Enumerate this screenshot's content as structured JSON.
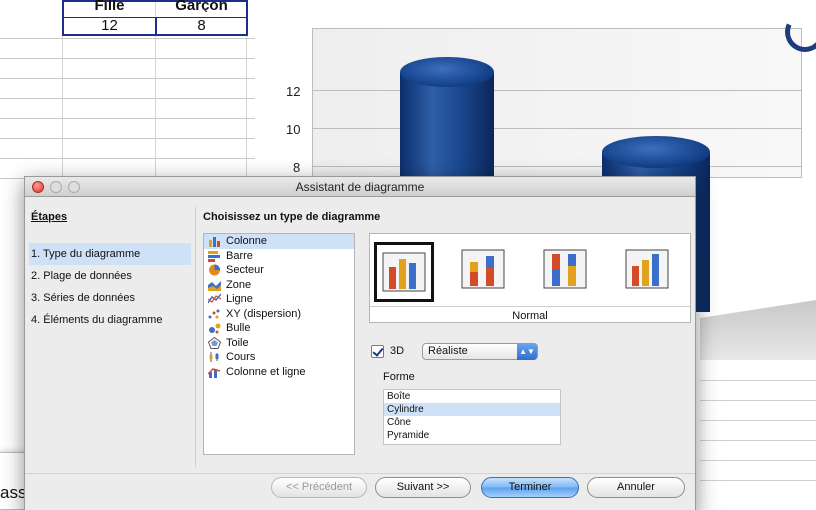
{
  "spreadsheet": {
    "headers": [
      "Fille",
      "Garçon"
    ],
    "values": [
      "12",
      "8"
    ]
  },
  "chart": {
    "y_ticks": [
      "12",
      "10",
      "8"
    ],
    "bar_color": "#1d4b93"
  },
  "background_window": {
    "text": "asse"
  },
  "dialog": {
    "title": "Assistant de diagramme",
    "steps_heading": "Étapes",
    "steps": [
      {
        "label": "1. Type du diagramme",
        "active": true
      },
      {
        "label": "2. Plage de données",
        "active": false
      },
      {
        "label": "3. Séries de données",
        "active": false
      },
      {
        "label": "4. Éléments du diagramme",
        "active": false
      }
    ],
    "main_heading": "Choisissez un type de diagramme",
    "chart_types": [
      {
        "label": "Colonne",
        "icon": "column-chart-icon",
        "selected": true
      },
      {
        "label": "Barre",
        "icon": "bar-chart-icon",
        "selected": false
      },
      {
        "label": "Secteur",
        "icon": "pie-chart-icon",
        "selected": false
      },
      {
        "label": "Zone",
        "icon": "area-chart-icon",
        "selected": false
      },
      {
        "label": "Ligne",
        "icon": "line-chart-icon",
        "selected": false
      },
      {
        "label": "XY (dispersion)",
        "icon": "scatter-chart-icon",
        "selected": false
      },
      {
        "label": "Bulle",
        "icon": "bubble-chart-icon",
        "selected": false
      },
      {
        "label": "Toile",
        "icon": "net-chart-icon",
        "selected": false
      },
      {
        "label": "Cours",
        "icon": "stock-chart-icon",
        "selected": false
      },
      {
        "label": "Colonne et ligne",
        "icon": "column-line-chart-icon",
        "selected": false
      }
    ],
    "variant_label": "Normal",
    "three_d": {
      "label": "3D",
      "checked": true,
      "select_value": "Réaliste"
    },
    "shape": {
      "label": "Forme",
      "options": [
        {
          "label": "Boîte",
          "selected": false
        },
        {
          "label": "Cylindre",
          "selected": true
        },
        {
          "label": "Cône",
          "selected": false
        },
        {
          "label": "Pyramide",
          "selected": false
        }
      ]
    },
    "buttons": {
      "previous": "<< Précédent",
      "next": "Suivant >>",
      "finish": "Terminer",
      "cancel": "Annuler"
    }
  }
}
